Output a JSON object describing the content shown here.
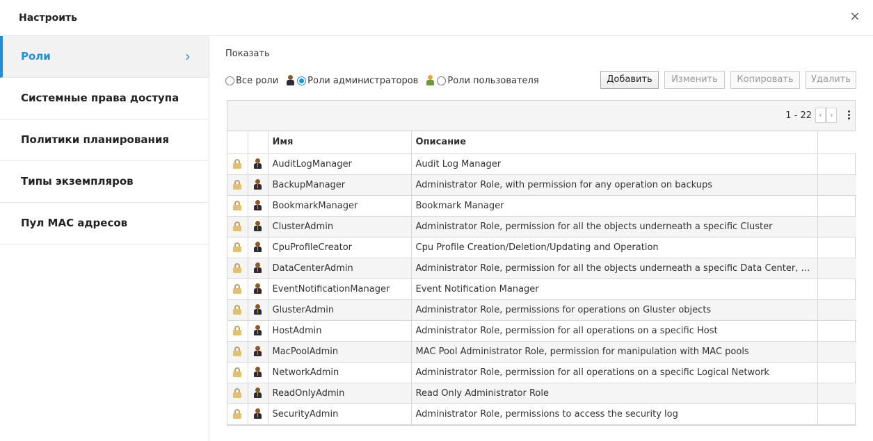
{
  "dialog": {
    "title": "Настроить",
    "close": "×"
  },
  "sidebar": {
    "items": [
      {
        "label": "Роли",
        "active": true
      },
      {
        "label": "Системные права доступа"
      },
      {
        "label": "Политики планирования"
      },
      {
        "label": "Типы экземпляров"
      },
      {
        "label": "Пул MAC адресов"
      }
    ],
    "chevron": "›"
  },
  "main": {
    "show_label": "Показать",
    "filters": {
      "all": "Все роли",
      "admin": "Роли администраторов",
      "user": "Роли пользователя",
      "selected": "admin"
    },
    "buttons": {
      "add": "Добавить",
      "edit": "Изменить",
      "copy": "Копировать",
      "delete": "Удалить"
    },
    "pager": {
      "range": "1 - 22",
      "prev": "‹",
      "next": "›"
    },
    "columns": {
      "name": "Имя",
      "description": "Описание"
    },
    "colors": {
      "accent": "#1d8fe0",
      "admin_head": "#8a5a2c",
      "user_head": "#e6a54a",
      "user_body": "#6a9a3a"
    },
    "rows": [
      {
        "name": "AuditLogManager",
        "description": "Audit Log Manager"
      },
      {
        "name": "BackupManager",
        "description": "Administrator Role, with permission for any operation on backups"
      },
      {
        "name": "BookmarkManager",
        "description": "Bookmark Manager"
      },
      {
        "name": "ClusterAdmin",
        "description": "Administrator Role, permission for all the objects underneath a specific Cluster"
      },
      {
        "name": "CpuProfileCreator",
        "description": "Cpu Profile Creation/Deletion/Updating and Operation"
      },
      {
        "name": "DataCenterAdmin",
        "description": "Administrator Role, permission for all the objects underneath a specific Data Center, e..."
      },
      {
        "name": "EventNotificationManager",
        "description": "Event Notification Manager"
      },
      {
        "name": "GlusterAdmin",
        "description": "Administrator Role, permissions for operations on Gluster objects"
      },
      {
        "name": "HostAdmin",
        "description": "Administrator Role, permission for all operations on a specific Host"
      },
      {
        "name": "MacPoolAdmin",
        "description": "MAC Pool Administrator Role, permission for manipulation with MAC pools"
      },
      {
        "name": "NetworkAdmin",
        "description": "Administrator Role, permission for all operations on a specific Logical Network"
      },
      {
        "name": "ReadOnlyAdmin",
        "description": "Read Only Administrator Role"
      },
      {
        "name": "SecurityAdmin",
        "description": "Administrator Role, permissions to access the security log"
      }
    ]
  }
}
